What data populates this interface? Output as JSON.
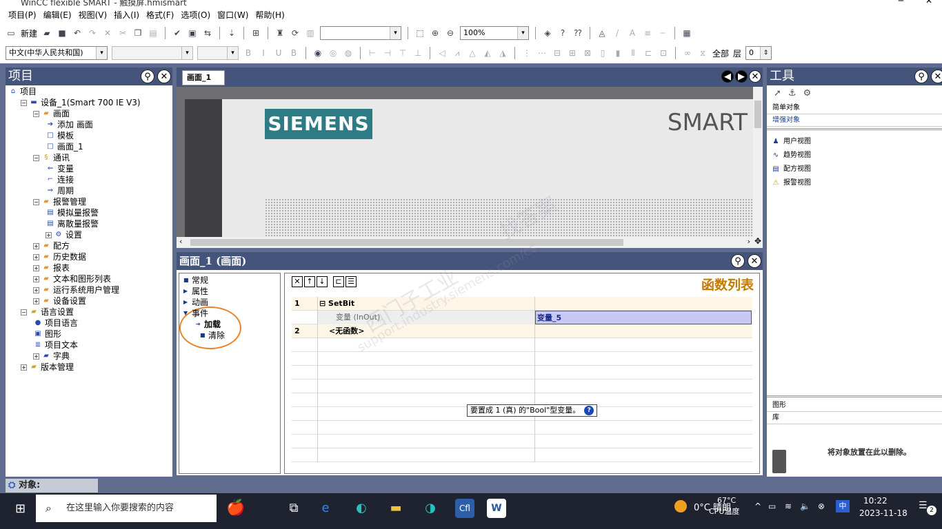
{
  "window": {
    "title": "WinCC flexible SMART - 触摸屏.hmismart",
    "minimize": "─",
    "close": "✕"
  },
  "menu": [
    "项目(P)",
    "编辑(E)",
    "视图(V)",
    "插入(I)",
    "格式(F)",
    "选项(O)",
    "窗口(W)",
    "帮助(H)"
  ],
  "toolbar1": {
    "new_label": "新建",
    "zoom_value": "100%"
  },
  "toolbar2": {
    "language_value": "中文(中华人民共和国)",
    "all_label": "全部",
    "layer_label": "层",
    "layer_value": "0"
  },
  "project_panel": {
    "title": "项目",
    "tree": [
      {
        "label": "项目",
        "indent": 0,
        "expander": "",
        "icon": "project-icon"
      },
      {
        "label": "设备_1(Smart 700 IE V3)",
        "indent": 1,
        "expander": "−",
        "icon": "device-icon"
      },
      {
        "label": "画面",
        "indent": 2,
        "expander": "−",
        "icon": "folder-icon"
      },
      {
        "label": "添加 画面",
        "indent": 3,
        "expander": "",
        "icon": "add-screen-icon"
      },
      {
        "label": "模板",
        "indent": 3,
        "expander": "",
        "icon": "template-icon"
      },
      {
        "label": "画面_1",
        "indent": 3,
        "expander": "",
        "icon": "screen-icon"
      },
      {
        "label": "通讯",
        "indent": 2,
        "expander": "−",
        "icon": "comm-folder-icon"
      },
      {
        "label": "变量",
        "indent": 3,
        "expander": "",
        "icon": "tag-icon"
      },
      {
        "label": "连接",
        "indent": 3,
        "expander": "",
        "icon": "connection-icon"
      },
      {
        "label": "周期",
        "indent": 3,
        "expander": "",
        "icon": "cycle-icon"
      },
      {
        "label": "报警管理",
        "indent": 2,
        "expander": "−",
        "icon": "alarm-folder-icon"
      },
      {
        "label": "模拟量报警",
        "indent": 3,
        "expander": "",
        "icon": "analog-alarm-icon"
      },
      {
        "label": "离散量报警",
        "indent": 3,
        "expander": "",
        "icon": "discrete-alarm-icon"
      },
      {
        "label": "设置",
        "indent": 3,
        "expander": "+",
        "icon": "settings-icon"
      },
      {
        "label": "配方",
        "indent": 2,
        "expander": "+",
        "icon": "recipe-folder-icon"
      },
      {
        "label": "历史数据",
        "indent": 2,
        "expander": "+",
        "icon": "history-folder-icon"
      },
      {
        "label": "报表",
        "indent": 2,
        "expander": "+",
        "icon": "report-folder-icon"
      },
      {
        "label": "文本和图形列表",
        "indent": 2,
        "expander": "+",
        "icon": "textlist-folder-icon"
      },
      {
        "label": "运行系统用户管理",
        "indent": 2,
        "expander": "+",
        "icon": "user-admin-folder-icon"
      },
      {
        "label": "设备设置",
        "indent": 2,
        "expander": "+",
        "icon": "device-settings-folder-icon"
      },
      {
        "label": "语言设置",
        "indent": 1,
        "expander": "−",
        "icon": "language-folder-icon"
      },
      {
        "label": "项目语言",
        "indent": 2,
        "expander": "",
        "icon": "globe-icon"
      },
      {
        "label": "图形",
        "indent": 2,
        "expander": "",
        "icon": "graphics-icon"
      },
      {
        "label": "项目文本",
        "indent": 2,
        "expander": "",
        "icon": "text-icon"
      },
      {
        "label": "字典",
        "indent": 2,
        "expander": "+",
        "icon": "dictionary-icon"
      },
      {
        "label": "版本管理",
        "indent": 1,
        "expander": "+",
        "icon": "version-folder-icon"
      }
    ]
  },
  "editor": {
    "tab_label": "画面_1",
    "brand": "SIEMENS",
    "model_text": "SMART"
  },
  "properties": {
    "title": "画面_1 (画面)",
    "nav": [
      {
        "label": "常规",
        "bullet": "■",
        "bold": false
      },
      {
        "label": "属性",
        "bullet": "▶",
        "bold": false
      },
      {
        "label": "动画",
        "bullet": "▶",
        "bold": false
      },
      {
        "label": "事件",
        "bullet": "▼",
        "bold": false
      },
      {
        "label": "加载",
        "bullet": "➔",
        "bold": true
      },
      {
        "label": "清除",
        "bullet": "■",
        "bold": false
      }
    ],
    "function_list_title": "函数列表",
    "rows": [
      {
        "num": "1",
        "col2": "⊟ SetBit",
        "col3": ""
      },
      {
        "num": "",
        "col2": "变量 (InOut)",
        "col3": "变量_5"
      },
      {
        "num": "2",
        "col2": "<无函数>",
        "col3": ""
      }
    ],
    "tooltip": "要置成 1 (真) 的\"Bool\"型变量。"
  },
  "tools_panel": {
    "title": "工具",
    "categories": [
      "简单对象",
      "增强对象"
    ],
    "items": [
      "用户视图",
      "趋势视图",
      "配方视图",
      "报警视图"
    ],
    "bottom_categories": [
      "图形",
      "库"
    ],
    "drop_hint": "将对象放置在此以删除。"
  },
  "object_bar": {
    "label": "对象:"
  },
  "taskbar": {
    "search_placeholder": "在这里输入你要搜索的内容",
    "weather": "0°C 晴朗",
    "cpu_temp": "67°C",
    "cpu_label": "CPU温度",
    "time": "10:22",
    "date": "2023-11-18",
    "notifications": "2"
  },
  "watermark": [
    "西门子工业",
    "找答案",
    "support.industry.siemens.com/cs"
  ]
}
